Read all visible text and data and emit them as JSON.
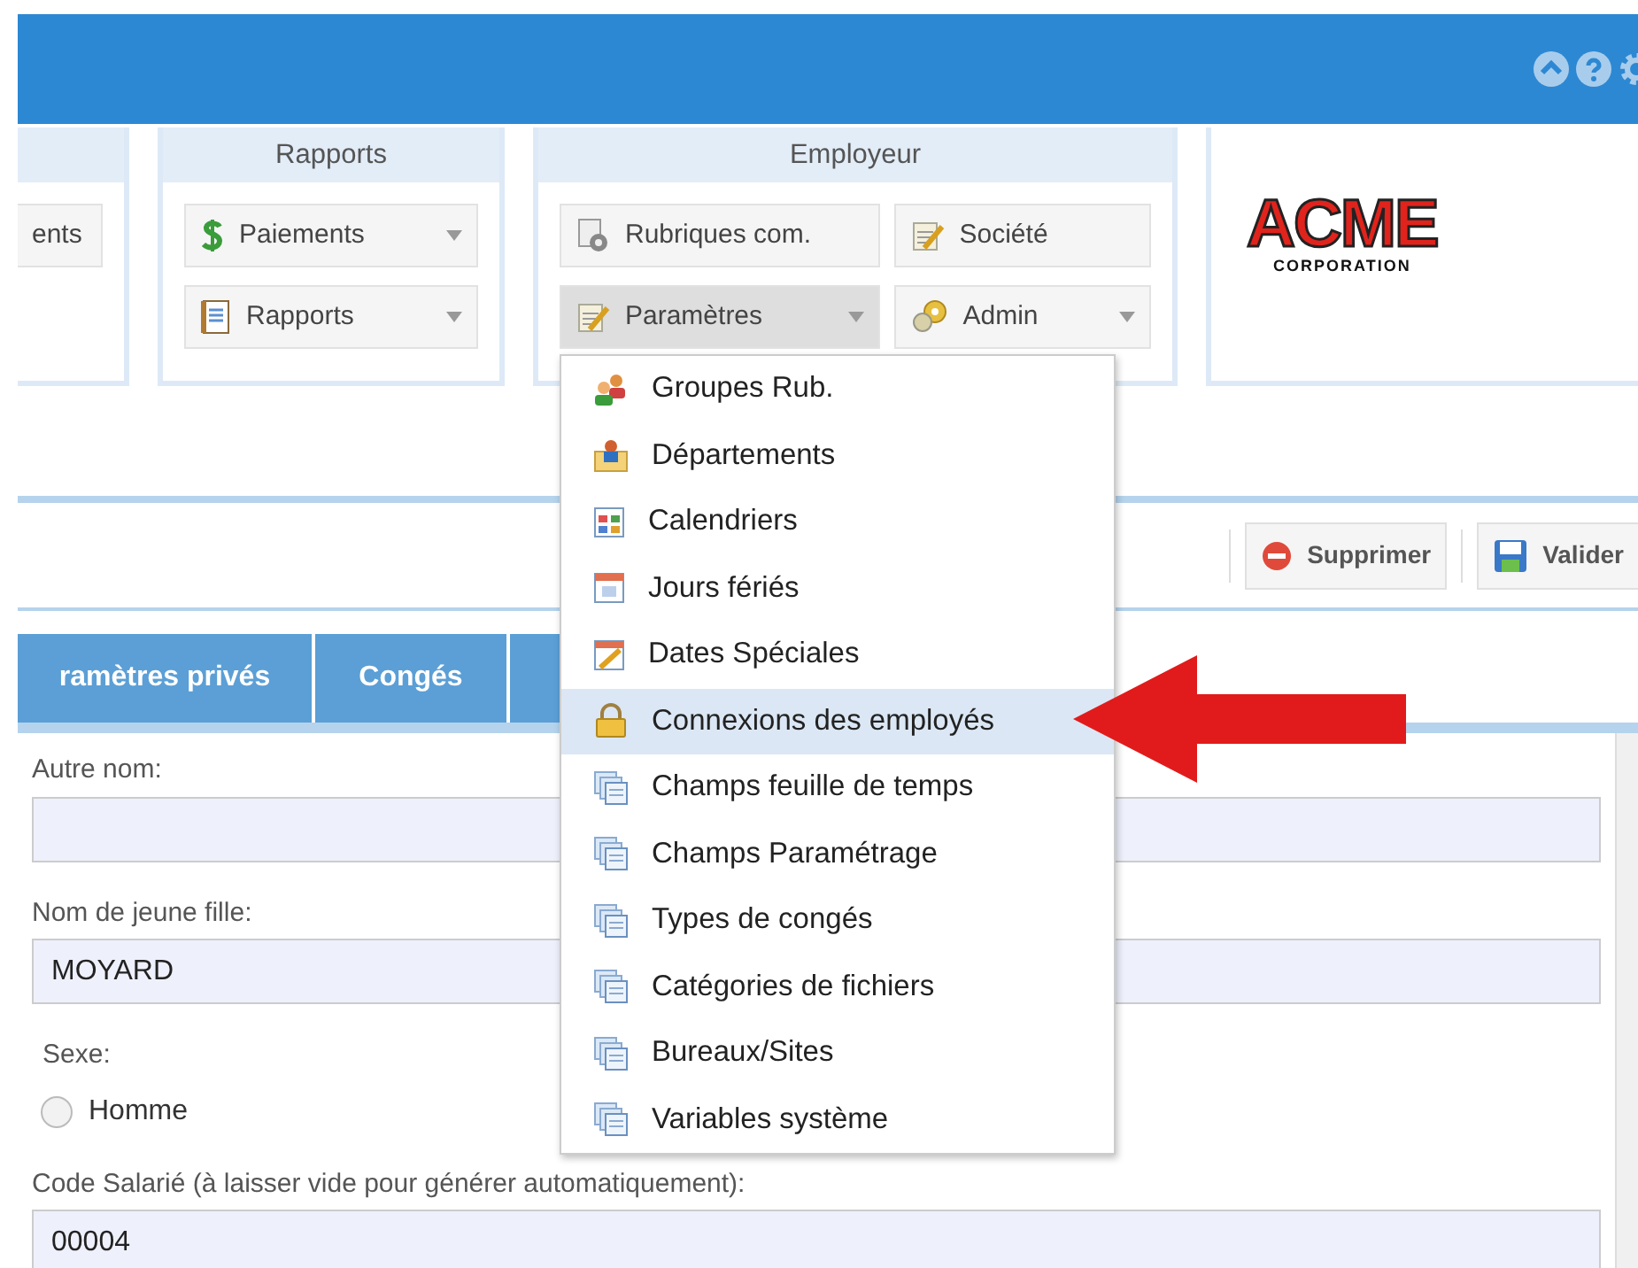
{
  "ribbon": {
    "groups": [
      {
        "buttons": [
          {
            "label": "ents",
            "dropdown": false,
            "pressed": false
          }
        ]
      },
      {
        "title": "Rapports",
        "buttons": [
          {
            "label": "Paiements",
            "dropdown": true,
            "pressed": false
          },
          {
            "label": "Rapports",
            "dropdown": true,
            "pressed": false
          }
        ]
      },
      {
        "title": "Employeur",
        "buttons": [
          {
            "label": "Rubriques com.",
            "dropdown": false,
            "pressed": false
          },
          {
            "label": "Société",
            "dropdown": false,
            "pressed": false
          },
          {
            "label": "Paramètres",
            "dropdown": true,
            "pressed": true
          },
          {
            "label": "Admin",
            "dropdown": true,
            "pressed": false
          }
        ]
      }
    ]
  },
  "logo": {
    "name": "ACME",
    "tagline": "CORPORATION"
  },
  "toolbar": {
    "buttons": [
      {
        "label": "Supprimer",
        "kind": "delete"
      },
      {
        "label": "Valider",
        "kind": "save"
      }
    ]
  },
  "tabs": [
    {
      "label": "ramètres privés"
    },
    {
      "label": "Congés"
    }
  ],
  "form": {
    "fields": [
      {
        "kind": "text",
        "label": "Autre nom:"
      },
      {
        "kind": "text",
        "label": "Nom de jeune fille:",
        "value": "MOYARD"
      },
      {
        "kind": "radio",
        "label": "Sexe:",
        "options": [
          {
            "label": "Homme",
            "checked": false
          }
        ]
      },
      {
        "kind": "text",
        "label": "Code Salarié (à laisser vide pour générer automatiquement):",
        "value": "00004"
      }
    ]
  },
  "menu": {
    "items": [
      {
        "label": "Groupes Rub.",
        "selected": false
      },
      {
        "label": "Départements",
        "selected": false
      },
      {
        "label": "Calendriers",
        "selected": false
      },
      {
        "label": "Jours fériés",
        "selected": false
      },
      {
        "label": "Dates Spéciales",
        "selected": false
      },
      {
        "label": "Connexions des employés",
        "selected": true
      },
      {
        "label": "Champs feuille de temps",
        "selected": false
      },
      {
        "label": "Champs Paramétrage",
        "selected": false
      },
      {
        "label": "Types de congés",
        "selected": false
      },
      {
        "label": "Catégories de fichiers",
        "selected": false
      },
      {
        "label": "Bureaux/Sites",
        "selected": false
      },
      {
        "label": "Variables système",
        "selected": false
      }
    ]
  }
}
